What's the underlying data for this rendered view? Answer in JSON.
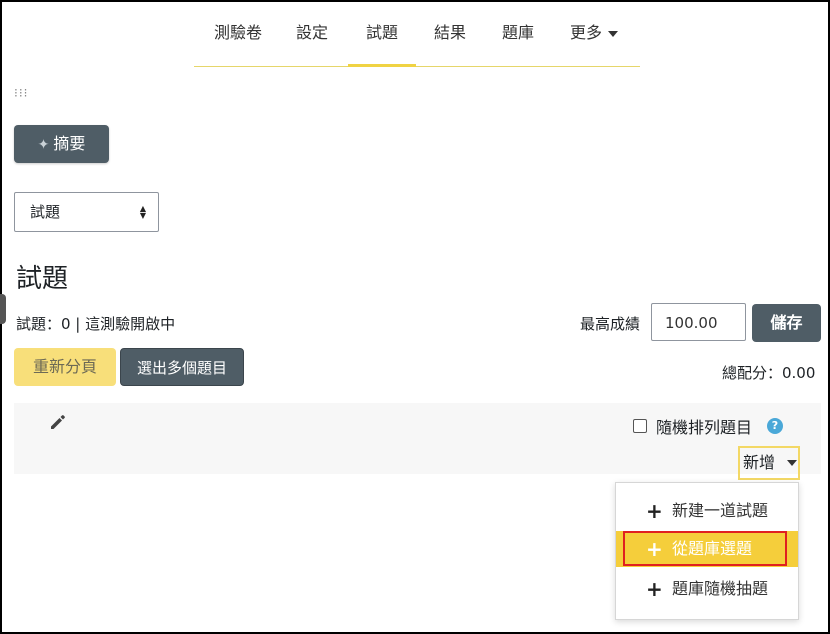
{
  "nav": {
    "items": [
      "測驗卷",
      "設定",
      "試題",
      "結果",
      "題庫",
      "更多"
    ],
    "active": "試題"
  },
  "summary_button": "摘要",
  "select": {
    "value": "試題"
  },
  "page_title": "試題",
  "status_text": "試題：0 | 這測驗開啟中",
  "max_grade": {
    "label": "最高成績",
    "value": "100.00"
  },
  "save_button": "儲存",
  "repaginate_button": "重新分頁",
  "select_multiple_button": "選出多個題目",
  "total_marks": "總配分：0.00",
  "shuffle": {
    "label": "隨機排列題目",
    "checked": false
  },
  "add_menu": {
    "toggle_label": "新增",
    "items": [
      "新建一道試題",
      "從題庫選題",
      "題庫隨機抽題"
    ],
    "highlighted_index": 1
  },
  "colors": {
    "primary": "#4f5d66",
    "accent": "#f5ce3b",
    "highlight_border": "#e02020",
    "help": "#4aa8d8"
  },
  "icons": {
    "summary": "sparkle-icon",
    "edit": "pencil-icon",
    "help": "question-icon",
    "add": "plus-icon"
  }
}
